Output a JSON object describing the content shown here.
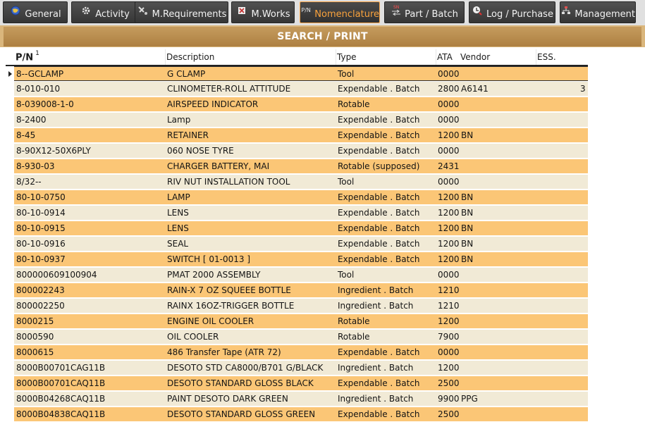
{
  "tabs": [
    {
      "label": "General",
      "icon": "globe-icon",
      "active": false
    },
    {
      "label": "Activity",
      "icon": "gear-icon",
      "active": false
    },
    {
      "label": "M.Requirements",
      "icon": "tools-icon",
      "active": false
    },
    {
      "label": "M.Works",
      "icon": "wrench-icon",
      "active": false
    },
    {
      "label": "Nomenclature",
      "icon": "pn-icon",
      "active": true
    },
    {
      "label": "Part / Batch",
      "icon": "part-batch-icon",
      "active": false
    },
    {
      "label": "Log / Purchase",
      "icon": "purchase-icon",
      "active": false
    },
    {
      "label": "Management",
      "icon": "org-chart-icon",
      "active": false
    }
  ],
  "tab_icon_text": {
    "pn": "P/N",
    "sn": "SN"
  },
  "header": {
    "title": "SEARCH / PRINT"
  },
  "grid": {
    "columns": {
      "pn": "P/N",
      "pn_sort_indicator": "1",
      "description": "Description",
      "type": "Type",
      "ata": "ATA",
      "vendor": "Vendor",
      "ess": "ESS."
    },
    "rows": [
      {
        "pn": "8--GCLAMP",
        "description": "G CLAMP",
        "type": "Tool",
        "ata": "0000",
        "vendor": "",
        "ess": "",
        "selected": true
      },
      {
        "pn": "8-010-010",
        "description": "CLINOMETER-ROLL ATTITUDE",
        "type": "Expendable . Batch",
        "ata": "2800",
        "vendor": "A6141",
        "ess": "3"
      },
      {
        "pn": "8-039008-1-0",
        "description": "AIRSPEED INDICATOR",
        "type": "Rotable",
        "ata": "0000",
        "vendor": "",
        "ess": ""
      },
      {
        "pn": "8-2400",
        "description": "Lamp",
        "type": "Expendable . Batch",
        "ata": "0000",
        "vendor": "",
        "ess": ""
      },
      {
        "pn": "8-45",
        "description": "RETAINER",
        "type": "Expendable . Batch",
        "ata": "1200",
        "vendor": "BN",
        "ess": ""
      },
      {
        "pn": "8-90X12-50X6PLY",
        "description": "060 NOSE TYRE",
        "type": "Expendable . Batch",
        "ata": "0000",
        "vendor": "",
        "ess": ""
      },
      {
        "pn": "8-930-03",
        "description": "CHARGER BATTERY, MAI",
        "type": "Rotable (supposed)",
        "ata": "2431",
        "vendor": "",
        "ess": ""
      },
      {
        "pn": "8/32--",
        "description": "RIV NUT INSTALLATION TOOL",
        "type": "Tool",
        "ata": "0000",
        "vendor": "",
        "ess": ""
      },
      {
        "pn": "80-10-0750",
        "description": "LAMP",
        "type": "Expendable . Batch",
        "ata": "1200",
        "vendor": "BN",
        "ess": ""
      },
      {
        "pn": "80-10-0914",
        "description": "LENS",
        "type": "Expendable . Batch",
        "ata": "1200",
        "vendor": "BN",
        "ess": ""
      },
      {
        "pn": "80-10-0915",
        "description": "LENS",
        "type": "Expendable . Batch",
        "ata": "1200",
        "vendor": "BN",
        "ess": ""
      },
      {
        "pn": "80-10-0916",
        "description": "SEAL",
        "type": "Expendable . Batch",
        "ata": "1200",
        "vendor": "BN",
        "ess": ""
      },
      {
        "pn": "80-10-0937",
        "description": "SWITCH [ 01-0013 ]",
        "type": "Expendable . Batch",
        "ata": "1200",
        "vendor": "BN",
        "ess": ""
      },
      {
        "pn": "800000609100904",
        "description": "PMAT 2000 ASSEMBLY",
        "type": "Tool",
        "ata": "0000",
        "vendor": "",
        "ess": ""
      },
      {
        "pn": "800002243",
        "description": "RAIN-X 7 OZ SQUEEE BOTTLE",
        "type": "Ingredient . Batch",
        "ata": "1210",
        "vendor": "",
        "ess": ""
      },
      {
        "pn": "800002250",
        "description": "RAINX 16OZ-TRIGGER BOTTLE",
        "type": "Ingredient . Batch",
        "ata": "1210",
        "vendor": "",
        "ess": ""
      },
      {
        "pn": "8000215",
        "description": "ENGINE OIL COOLER",
        "type": "Rotable",
        "ata": "1200",
        "vendor": "",
        "ess": ""
      },
      {
        "pn": "8000590",
        "description": "OIL COOLER",
        "type": "Rotable",
        "ata": "7900",
        "vendor": "",
        "ess": ""
      },
      {
        "pn": "8000615",
        "description": "486 Transfer Tape (ATR 72)",
        "type": "Expendable . Batch",
        "ata": "0000",
        "vendor": "",
        "ess": ""
      },
      {
        "pn": "8000B00701CAG11B",
        "description": "DESOTO STD CA8000/B701 G/BLACK",
        "type": "Ingredient . Batch",
        "ata": "1200",
        "vendor": "",
        "ess": ""
      },
      {
        "pn": "8000B00701CAQ11B",
        "description": "DESOTO STANDARD GLOSS BLACK",
        "type": "Expendable . Batch",
        "ata": "2500",
        "vendor": "",
        "ess": ""
      },
      {
        "pn": "8000B04268CAQ11B",
        "description": "PAINT DESOTO DARK GREEN",
        "type": "Ingredient . Batch",
        "ata": "9900",
        "vendor": "PPG",
        "ess": ""
      },
      {
        "pn": "8000B04838CAQ11B",
        "description": "DESOTO STANDARD GLOSS GREEN",
        "type": "Expendable . Batch",
        "ata": "2500",
        "vendor": "",
        "ess": ""
      }
    ]
  },
  "colors": {
    "row_odd": "#fbc676",
    "row_even": "#f1ead6",
    "header_band": "#dab67c",
    "tab_bg": "#3f3f3f",
    "tab_active_text": "#f9a23c"
  }
}
